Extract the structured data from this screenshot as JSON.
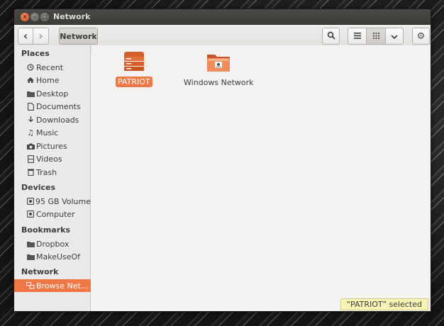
{
  "window": {
    "title": "Network",
    "close_glyph": "×",
    "minimize_glyph": "–",
    "maximize_glyph": "□"
  },
  "toolbar": {
    "back_icon": "‹",
    "forward_icon": "›",
    "breadcrumb": "Network",
    "search_icon": "search-icon",
    "view_list_icon": "≡",
    "view_grid_icon": "⋮⋮⋮",
    "view_menu_icon": "⌄",
    "gear_icon": "⚙"
  },
  "sidebar": {
    "places_header": "Places",
    "places": [
      {
        "label": "Recent",
        "icon": "clock-icon"
      },
      {
        "label": "Home",
        "icon": "home-icon"
      },
      {
        "label": "Desktop",
        "icon": "folder-icon"
      },
      {
        "label": "Documents",
        "icon": "document-icon"
      },
      {
        "label": "Downloads",
        "icon": "download-icon"
      },
      {
        "label": "Music",
        "icon": "music-icon"
      },
      {
        "label": "Pictures",
        "icon": "camera-icon"
      },
      {
        "label": "Videos",
        "icon": "film-icon"
      },
      {
        "label": "Trash",
        "icon": "trash-icon"
      }
    ],
    "devices_header": "Devices",
    "devices": [
      {
        "label": "95 GB Volume",
        "icon": "drive-icon"
      },
      {
        "label": "Computer",
        "icon": "drive-icon"
      }
    ],
    "bookmarks_header": "Bookmarks",
    "bookmarks": [
      {
        "label": "Dropbox",
        "icon": "folder-icon"
      },
      {
        "label": "MakeUseOf",
        "icon": "folder-icon"
      }
    ],
    "network_header": "Network",
    "network": [
      {
        "label": "Browse Net…",
        "icon": "network-icon",
        "active": true
      }
    ]
  },
  "files": [
    {
      "label": "PATRIOT",
      "icon": "server-icon",
      "selected": true
    },
    {
      "label": "Windows Network",
      "icon": "network-folder-icon",
      "selected": false
    }
  ],
  "status": "“PATRIOT” selected",
  "colors": {
    "accent": "#f07746",
    "titlebar": "#3c3b37",
    "status_bg": "#f6f3b5"
  }
}
